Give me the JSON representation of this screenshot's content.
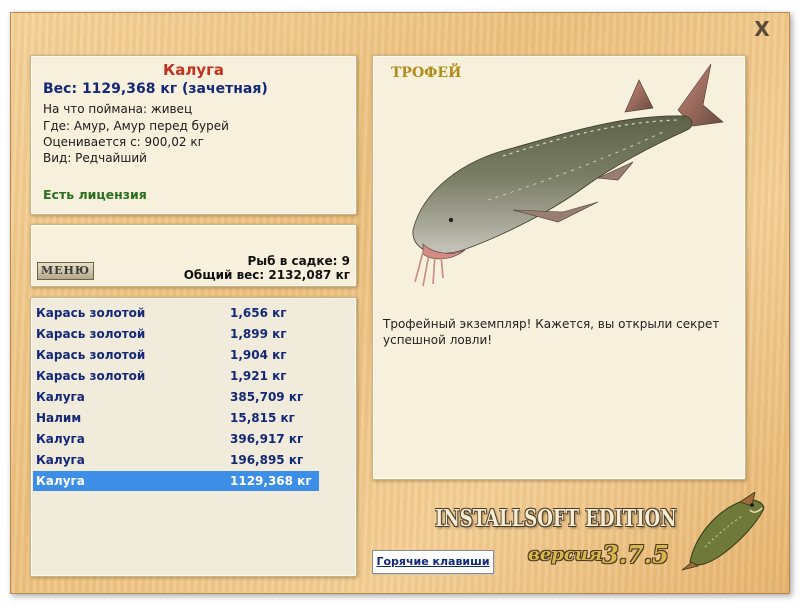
{
  "window": {
    "close_symbol": "X"
  },
  "fish_info": {
    "name": "Калуга",
    "weight": "Вес: 1129,368 кг (зачетная)",
    "bait": "На что поймана: живец",
    "location": "Где: Амур, Амур перед бурей",
    "value": "Оценивается с: 900,02 кг",
    "rarity": "Вид: Редчайший",
    "license": "Есть лицензия"
  },
  "cage": {
    "menu_label": "МЕНЮ",
    "fish_count": "Рыб в садке: 9",
    "total_weight": "Общий вес: 2132,087 кг"
  },
  "catch_list": [
    {
      "name": "Карась золотой",
      "weight": "1,656 кг"
    },
    {
      "name": "Карась золотой",
      "weight": "1,899 кг"
    },
    {
      "name": "Карась золотой",
      "weight": "1,904 кг"
    },
    {
      "name": "Карась золотой",
      "weight": "1,921 кг"
    },
    {
      "name": "Калуга",
      "weight": "385,709 кг"
    },
    {
      "name": "Налим",
      "weight": "15,815 кг"
    },
    {
      "name": "Калуга",
      "weight": "396,917 кг"
    },
    {
      "name": "Калуга",
      "weight": "196,895 кг"
    },
    {
      "name": "Калуга",
      "weight": "1129,368 кг",
      "selected": true
    }
  ],
  "trophy": {
    "title": "ТРОФЕЙ",
    "description": "Трофейный экземпляр! Кажется, вы открыли секрет успешной ловли!",
    "image_icon": "kaluga-fish-image"
  },
  "footer": {
    "hotkeys_label": "Горячие клавиши",
    "brand": "INSTALLSOFT EDITION",
    "version_word": "версия",
    "version_number": "3.7.5",
    "logo_icon": "pike-logo"
  },
  "colors": {
    "fish_name": "#c0321e",
    "weight_text": "#142878",
    "license": "#2a6e1e",
    "trophy_title": "#b08d1a",
    "selection": "#3d8ee6",
    "wood": "#ecc17f"
  }
}
